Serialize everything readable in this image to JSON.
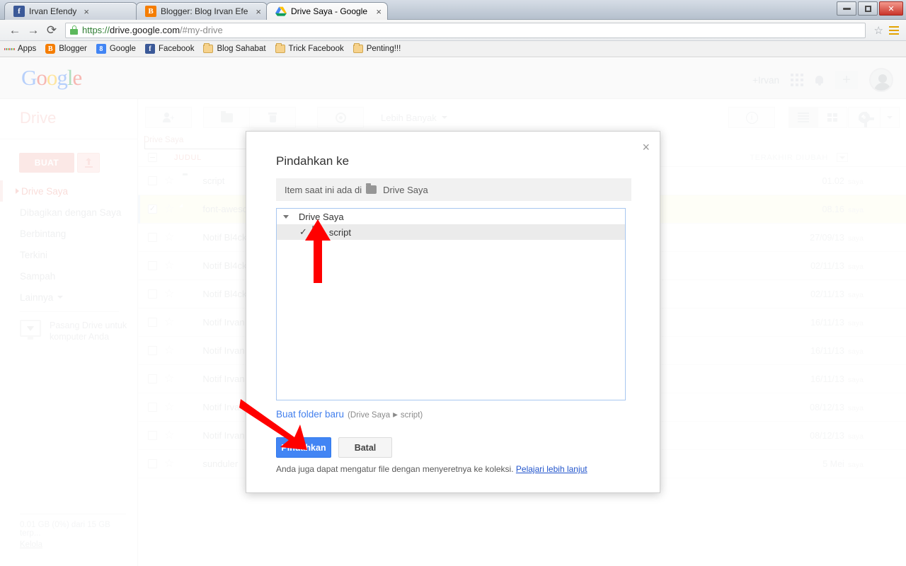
{
  "browser": {
    "tabs": [
      {
        "title": "Irvan Efendy",
        "favicon": "facebook-icon",
        "active": false
      },
      {
        "title": "Blogger: Blog Irvan Efend",
        "favicon": "blogger-icon",
        "active": false
      },
      {
        "title": "Drive Saya - Google Drive",
        "favicon": "google-drive-icon",
        "active": true
      }
    ],
    "tab_close_label": "×",
    "window_controls": {
      "minimize": "minimize-icon",
      "maximize": "maximize-icon",
      "close": "✕"
    },
    "nav": {
      "back": "←",
      "forward": "→",
      "reload": "⟳"
    },
    "url": {
      "scheme": "https://",
      "host": "drive.google.com",
      "rest": "/#my-drive",
      "full": "https://drive.google.com/#my-drive"
    },
    "bookmarks": [
      {
        "label": "Apps",
        "icon": "apps-grid-icon"
      },
      {
        "label": "Blogger",
        "icon": "blogger-icon"
      },
      {
        "label": "Google",
        "icon": "google-plus-icon"
      },
      {
        "label": "Facebook",
        "icon": "facebook-icon"
      },
      {
        "label": "Blog Sahabat",
        "icon": "folder-icon"
      },
      {
        "label": "Trick Facebook",
        "icon": "folder-icon"
      },
      {
        "label": "Penting!!!",
        "icon": "folder-icon"
      }
    ]
  },
  "gbar": {
    "logo": {
      "g1": "G",
      "o1": "o",
      "o2": "o",
      "g2": "g",
      "l": "l",
      "e": "e"
    },
    "account_name": "+Irvan",
    "search_placeholder": ""
  },
  "sidebar": {
    "product": "Drive",
    "create_button": "BUAT",
    "upload_button": "upload-icon",
    "nav_items": [
      {
        "label": "Drive Saya",
        "active": true
      },
      {
        "label": "Dibagikan dengan Saya",
        "active": false
      },
      {
        "label": "Berbintang",
        "active": false
      },
      {
        "label": "Terkini",
        "active": false
      },
      {
        "label": "Sampah",
        "active": false
      },
      {
        "label": "Lainnya",
        "active": false,
        "caret": true
      }
    ],
    "install": "Pasang Drive untuk komputer Anda",
    "storage_text": "0.01 GB (0%) dari 15 GB terp...",
    "storage_link": "Kelola"
  },
  "toolbar": {
    "share": "share-person-icon",
    "folder": "folder-icon",
    "trash": "trash-icon",
    "preview": "preview-eye-icon",
    "more_label": "Lebih Banyak",
    "details": "info-icon",
    "list_view": "list-view-icon",
    "grid_view": "grid-view-icon",
    "settings": "gear-icon"
  },
  "filelist": {
    "breadcrumb": "Drive Saya",
    "col_title": "JUDUL",
    "col_modified": "TERAKHIR DIUBAH",
    "rows": [
      {
        "name": "script",
        "type": "folder",
        "date": "01.02",
        "owner": "saya",
        "checked": false,
        "selected": false
      },
      {
        "name": "font-aweso",
        "type": "doc",
        "date": "08.16",
        "owner": "saya",
        "checked": true,
        "selected": true
      },
      {
        "name": "Notif Bl4ck",
        "type": "link",
        "date": "27/09/13",
        "owner": "saya",
        "checked": false,
        "selected": false
      },
      {
        "name": "Notif Bl4ck",
        "type": "link",
        "date": "02/11/13",
        "owner": "saya",
        "checked": false,
        "selected": false
      },
      {
        "name": "Notif Bl4ck",
        "type": "link",
        "date": "02/11/13",
        "owner": "saya",
        "checked": false,
        "selected": false
      },
      {
        "name": "Notif Irvan A",
        "type": "link",
        "date": "16/11/13",
        "owner": "saya",
        "checked": false,
        "selected": false
      },
      {
        "name": "Notif Irvan A",
        "type": "link",
        "date": "16/11/13",
        "owner": "saya",
        "checked": false,
        "selected": false
      },
      {
        "name": "Notif Irvan A",
        "type": "link",
        "date": "16/11/13",
        "owner": "saya",
        "checked": false,
        "selected": false
      },
      {
        "name": "Notif Irvan A",
        "type": "link",
        "date": "08/12/13",
        "owner": "saya",
        "checked": false,
        "selected": false
      },
      {
        "name": "Notif Irvan A",
        "type": "link",
        "date": "08/12/13",
        "owner": "saya",
        "checked": false,
        "selected": false
      },
      {
        "name": "sunduler",
        "type": "link",
        "date": "5 Mei",
        "owner": "saya",
        "checked": false,
        "selected": false
      }
    ]
  },
  "modal": {
    "title": "Pindahkan ke",
    "close": "×",
    "current_location_prefix": "Item saat ini ada di",
    "current_location_folder": "Drive Saya",
    "tree": [
      {
        "label": "Drive Saya",
        "level": 0,
        "expanded": true,
        "checked": false,
        "selected": false
      },
      {
        "label": "script",
        "level": 1,
        "expanded": false,
        "checked": true,
        "selected": true
      }
    ],
    "new_folder_link": "Buat folder baru",
    "new_folder_path_open": "(Drive Saya",
    "new_folder_path_sep": "▸",
    "new_folder_path_close": "script)",
    "primary_button": "Pindahkan",
    "cancel_button": "Batal",
    "footer_text": "Anda juga dapat mengatur file dengan menyeretnya ke koleksi.",
    "footer_link": "Pelajari lebih lanjut"
  },
  "annotations": {
    "arrow_up": "red-arrow-up",
    "arrow_diagonal": "red-arrow-diagonal",
    "color": "#ff0000"
  }
}
